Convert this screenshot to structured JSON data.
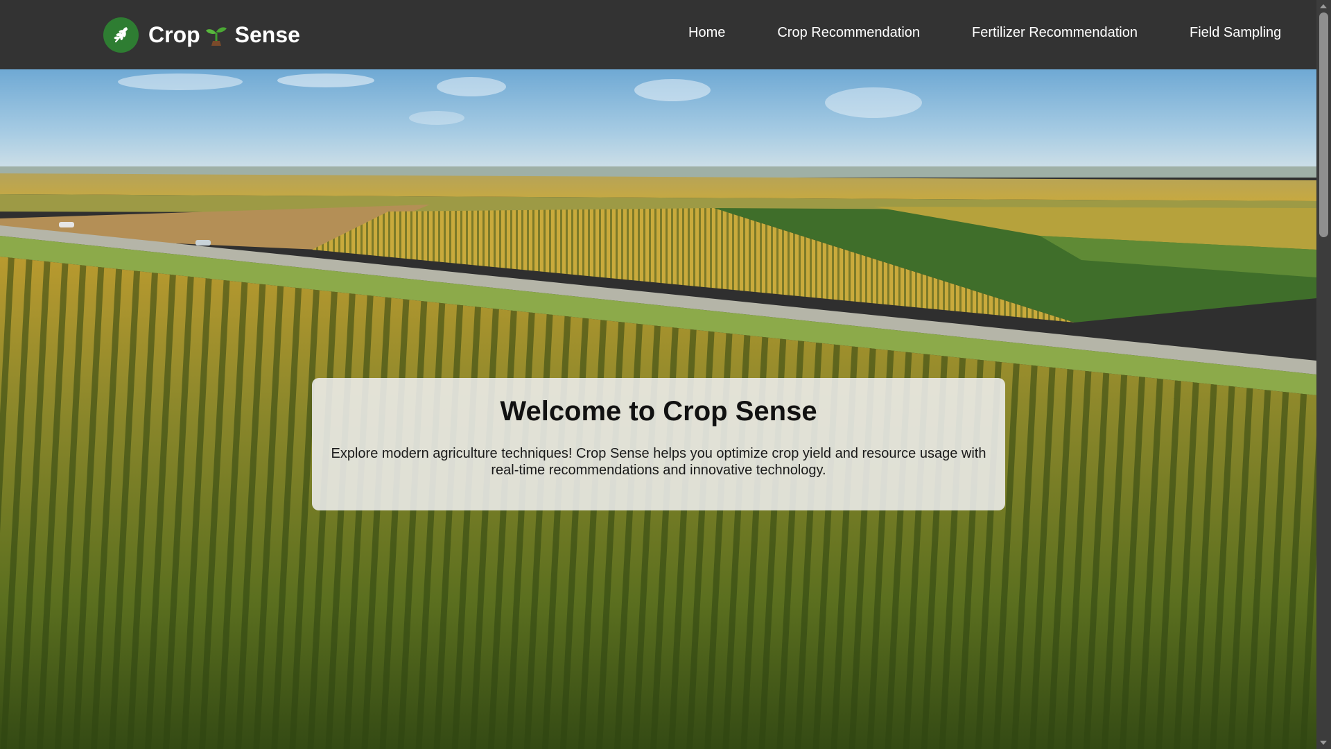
{
  "brand": {
    "name_part1": "Crop",
    "name_part2": "Sense",
    "logo_icon": "wheat-leaf-icon",
    "separator_icon": "seedling-icon"
  },
  "nav": {
    "items": [
      {
        "label": "Home"
      },
      {
        "label": "Crop Recommendation"
      },
      {
        "label": "Fertilizer Recommendation"
      },
      {
        "label": "Field Sampling"
      }
    ]
  },
  "hero": {
    "background": "aerial photo of cornfields under a blue sky",
    "title": "Welcome to Crop Sense",
    "description": "Explore modern agriculture techniques! Crop Sense helps you optimize crop yield and resource usage with real-time recommendations and innovative technology."
  },
  "colors": {
    "navbar": "#333333",
    "brand_green": "#2e7d32",
    "nav_text": "#ffffff"
  }
}
